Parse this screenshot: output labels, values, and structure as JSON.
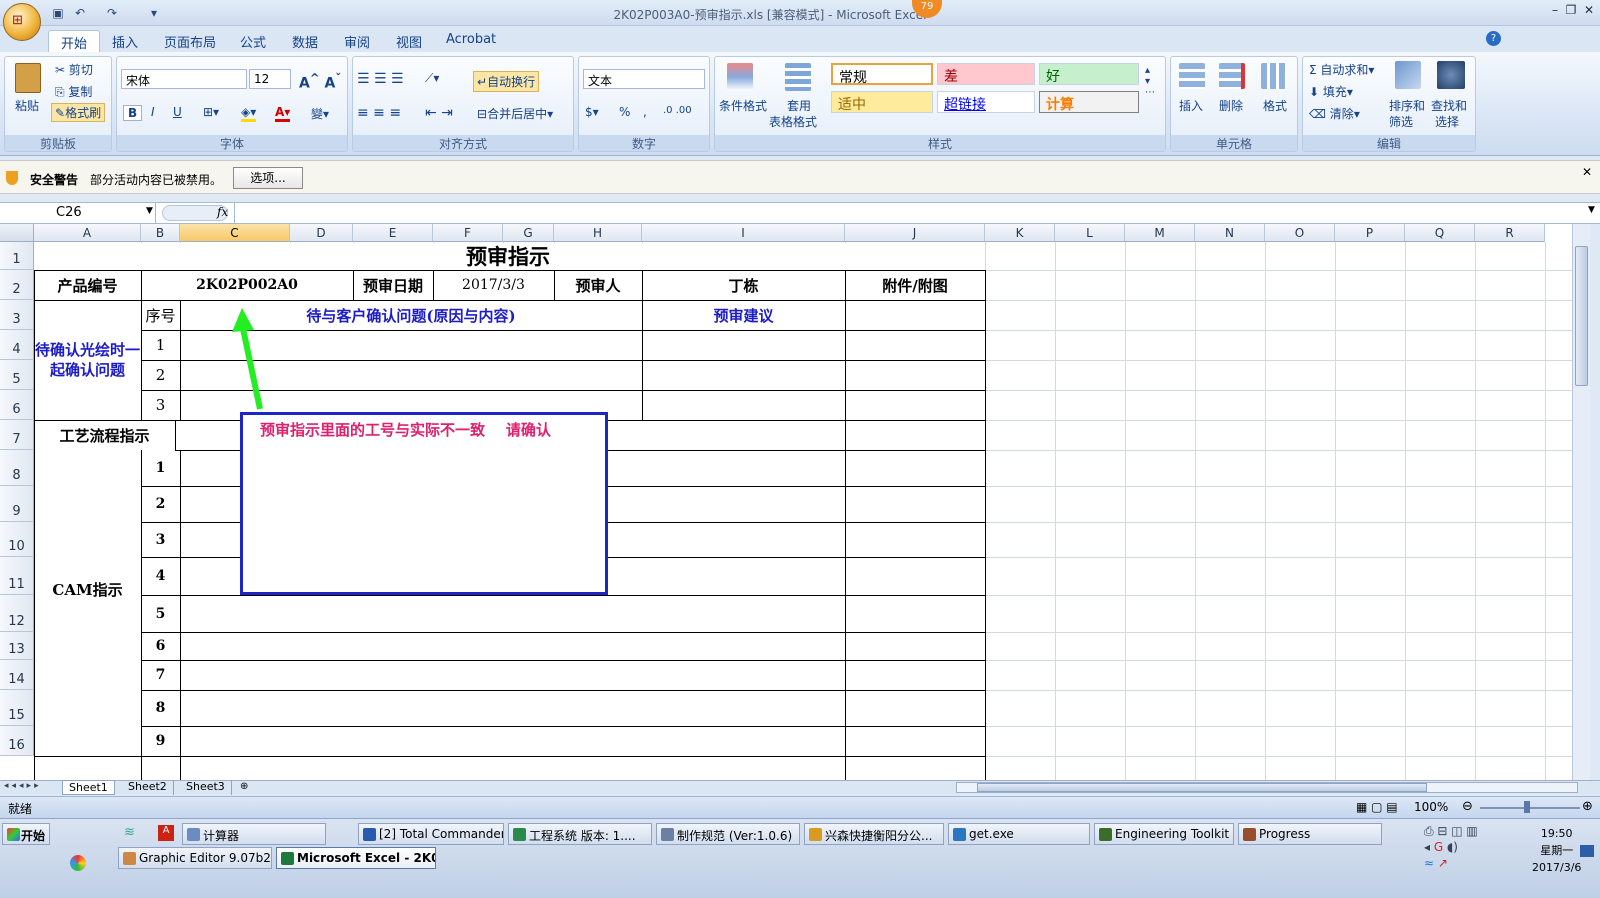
{
  "window": {
    "title": "2K02P003A0-预审指示.xls  [兼容模式] - Microsoft Excel",
    "badge": "79"
  },
  "tabs": [
    "开始",
    "插入",
    "页面布局",
    "公式",
    "数据",
    "审阅",
    "视图",
    "Acrobat"
  ],
  "ribbon": {
    "clipboard": {
      "paste": "粘贴",
      "cut": "剪切",
      "copy": "复制",
      "format_painter": "格式刷",
      "group": "剪贴板"
    },
    "font": {
      "name": "宋体",
      "size": "12",
      "group": "字体",
      "bold": "B",
      "italic": "I",
      "underline": "U"
    },
    "alignment": {
      "wrap": "自动换行",
      "merge": "合并后居中",
      "group": "对齐方式"
    },
    "number": {
      "format": "文本",
      "percent": "%",
      "comma": ",",
      "group": "数字"
    },
    "styles": {
      "conditional": "条件格式",
      "table": "套用",
      "table2": "表格格式",
      "normal": "常规",
      "bad": "差",
      "good": "好",
      "neutral": "适中",
      "hyperlink": "超链接",
      "calc": "计算",
      "group": "样式"
    },
    "cells": {
      "insert": "插入",
      "delete": "删除",
      "format": "格式",
      "group": "单元格"
    },
    "editing": {
      "autosum": "自动求和",
      "fill": "填充",
      "clear": "清除",
      "sort": "排序和",
      "sort2": "筛选",
      "find": "查找和",
      "find2": "选择",
      "group": "编辑"
    }
  },
  "security": {
    "title": "安全警告",
    "message": "部分活动内容已被禁用。",
    "options": "选项..."
  },
  "formula": {
    "namebox": "C26",
    "fx": "fx",
    "value": ""
  },
  "columns": [
    "A",
    "B",
    "C",
    "D",
    "E",
    "F",
    "G",
    "H",
    "I",
    "J",
    "K",
    "L",
    "M",
    "N",
    "O",
    "P",
    "Q",
    "R"
  ],
  "rows": [
    "1",
    "2",
    "3",
    "4",
    "5",
    "6",
    "7",
    "8",
    "9",
    "10",
    "11",
    "12",
    "13",
    "14",
    "15",
    "16"
  ],
  "sheet": {
    "title": "预审指示",
    "product_label": "产品编号",
    "product_value": "2K02P002A0",
    "date_label": "预审日期",
    "date_value": "2017/3/3",
    "reviewer_label": "预审人",
    "reviewer_value": "丁栋",
    "attach_label": "附件/附图",
    "seq_label": "序号",
    "issue_label": "待与客户确认问题(原因与内容)",
    "advice_label": "预审建议",
    "pending_label": "待确认光绘时一起确认问题",
    "pending_nums": [
      "1",
      "2",
      "3"
    ],
    "process_label": "工艺流程指示",
    "cam_label": "CAM指示",
    "cam_nums": [
      "1",
      "2",
      "3",
      "4",
      "5",
      "6",
      "7",
      "8",
      "9"
    ],
    "annotation": "预审指示里面的工号与实际不一致    请确认",
    "annotation_color": "#e0206e",
    "arrow_color": "#22ee22"
  },
  "sheet_tabs": [
    "Sheet1",
    "Sheet2",
    "Sheet3"
  ],
  "status": {
    "ready": "就绪",
    "zoom": "100%"
  },
  "taskbar": {
    "start": "开始",
    "row1": [
      "计算器",
      "[2] Total Commander ...",
      "工程系统  版本: 1....",
      "制作规范 (Ver:1.0.6)",
      "兴森快捷衡阳分公...",
      "get.exe",
      "Engineering Toolkit 9....",
      "Progress"
    ],
    "row2": [
      "Graphic Editor 9.07b2 (0...",
      "Microsoft Excel - 2K0..."
    ],
    "time": "19:50",
    "weekday": "星期一",
    "date": "2017/3/6"
  }
}
